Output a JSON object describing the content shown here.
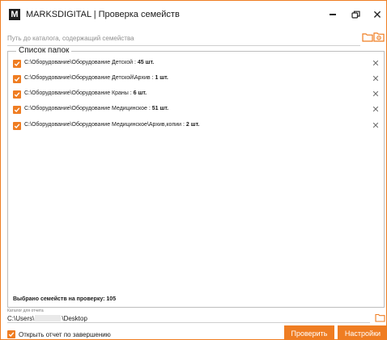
{
  "window": {
    "logo_letter": "M",
    "title": "MARKSDIGITAL | Проверка семейств"
  },
  "path_input": {
    "placeholder": "Путь до каталога, содержащий семейства",
    "value": ""
  },
  "folders": {
    "legend": "Список папок",
    "items": [
      {
        "path": "C:\\Оборудование\\Оборудование Детской",
        "count": "45 шт.",
        "checked": true
      },
      {
        "path": "C:\\Оборудование\\Оборудование Детской\\Архив",
        "count": "1 шт.",
        "checked": true
      },
      {
        "path": "C:\\Оборудование\\Оборудование Краны",
        "count": "6 шт.",
        "checked": true
      },
      {
        "path": "C:\\Оборудование\\Оборудование Медицинское",
        "count": "51 шт.",
        "checked": true
      },
      {
        "path": "C:\\Оборудование\\Оборудование Медицинское\\Архив,копии",
        "count": "2 шт.",
        "checked": true
      }
    ],
    "separator": " : ",
    "remove_glyph": "✕",
    "selected_text": "Выбрано семейств на проверку: 105"
  },
  "report": {
    "label": "Каталог для отчета",
    "path_prefix": "C:\\Users\\",
    "path_suffix": "\\Desktop"
  },
  "bottom": {
    "open_report_label": "Открыть отчет по завершению",
    "open_report_checked": true,
    "check_button": "Проверить",
    "settings_button": "Настройки"
  },
  "colors": {
    "accent": "#ef7d22",
    "border": "#bdbdbd"
  },
  "icons": {
    "browse": "folder-open-icon",
    "browse_special": "folder-settings-icon",
    "remove": "close-icon",
    "checkbox": "checkmark-icon"
  }
}
